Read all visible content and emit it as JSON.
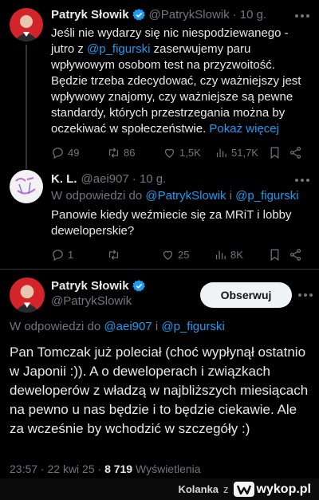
{
  "tweet1": {
    "name": "Patryk Słowik",
    "handle": "@PatrykSlowik",
    "time": "· 10 g.",
    "text_a": "Jeśli nie wydarzy się nic niespodziewanego - jutro z ",
    "mention": "@p_figurski",
    "text_b": " zaserwujemy paru wpływowym osobom test na przyzwoitość. Będzie trzeba zdecydować, czy ważniejszy jest wpływowy znajomy, czy ważniejsze są pewne standardy, których przestrzegania można by oczekiwać w społeczeństwie. ",
    "show_more": "Pokaż więcej",
    "replies": "49",
    "retweets": "86",
    "likes": "1,5K",
    "views": "51,7K"
  },
  "tweet2": {
    "name": "K. L.",
    "handle": "@aei907",
    "time": "· 10 g.",
    "reply_prefix": "W odpowiedzi do ",
    "reply_to_1": "@PatrykSlowik",
    "reply_and": " i ",
    "reply_to_2": "@p_figurski",
    "text": "Panowie kiedy weźmiecie się za MRiT i lobby deweloperskie?",
    "replies": "1",
    "retweets": "",
    "likes": "25",
    "views": "8K"
  },
  "tweet3": {
    "name": "Patryk Słowik",
    "handle": "@PatrykSlowik",
    "follow": "Obserwuj",
    "reply_prefix": "W odpowiedzi do ",
    "reply_to_1": "@aei907",
    "reply_and": " i ",
    "reply_to_2": "@p_figurski",
    "text": "Pan Tomczak już poleciał (choć wypłynął ostatnio w Japonii :)). A o deweloperach i związkach deweloperów z władzą w najbliższych miesiącach na pewno u nas będzie i to będzie ciekawie. Ale za wcześnie by wchodzić w szczegóły :)",
    "timestamp": "23:57 · 22 kwi 25 · ",
    "views_count": "8 719",
    "views_label": " Wyświetlenia"
  },
  "footer": {
    "user": "Kolanka",
    "z": "z",
    "site": "wykop.pl"
  },
  "colors": {
    "accent": "#1d9bf0",
    "muted": "#71767b",
    "text": "#e7e9ea"
  },
  "icons": [
    "verified-icon",
    "reply-icon",
    "retweet-icon",
    "like-icon",
    "views-icon",
    "bookmark-icon",
    "share-icon"
  ]
}
